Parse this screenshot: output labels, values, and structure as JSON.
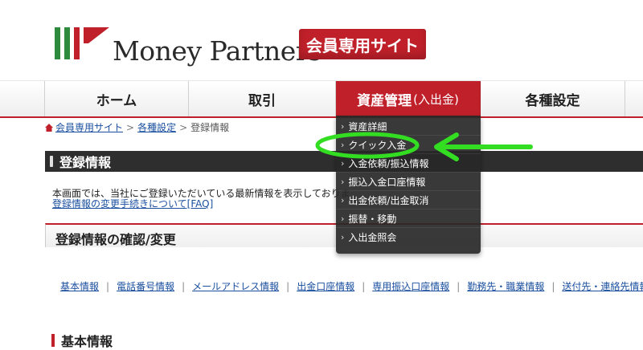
{
  "header": {
    "brand": "Money Partners",
    "member_badge": "会員専用サイト"
  },
  "nav": {
    "items": [
      {
        "label": "ホーム",
        "sub": ""
      },
      {
        "label": "取引",
        "sub": ""
      },
      {
        "label": "資産管理",
        "sub": "(入出金)"
      },
      {
        "label": "各種設定",
        "sub": ""
      }
    ]
  },
  "breadcrumb": {
    "items": [
      "会員専用サイト",
      "各種設定",
      "登録情報"
    ]
  },
  "dropdown": {
    "items": [
      "資産詳細",
      "クイック入金",
      "入金依頼/振込情報",
      "振込入金口座情報",
      "出金依頼/出金取消",
      "振替・移動",
      "入出金照会"
    ]
  },
  "page": {
    "title": "登録情報",
    "description": "本画面では、当社にご登録いただいている最新情報を表示しておりま",
    "faq_link": "登録情報の変更手続きについて[FAQ]",
    "section_title": "登録情報の確認/変更",
    "tabs": [
      "基本情報",
      "電話番号情報",
      "メールアドレス情報",
      "出金口座情報",
      "専用振込口座情報",
      "勤務先・職業情報",
      "送付先・連絡先情報"
    ],
    "sub_heading": "基本情報"
  },
  "colors": {
    "brand_red": "#c0202a",
    "logo_green": "#2e8b3e",
    "annotation_green": "#33dd22",
    "link_blue": "#1a4fa0"
  },
  "annotation": {
    "highlight_icon": "green-ellipse-highlight",
    "arrow_icon": "green-left-arrow"
  }
}
